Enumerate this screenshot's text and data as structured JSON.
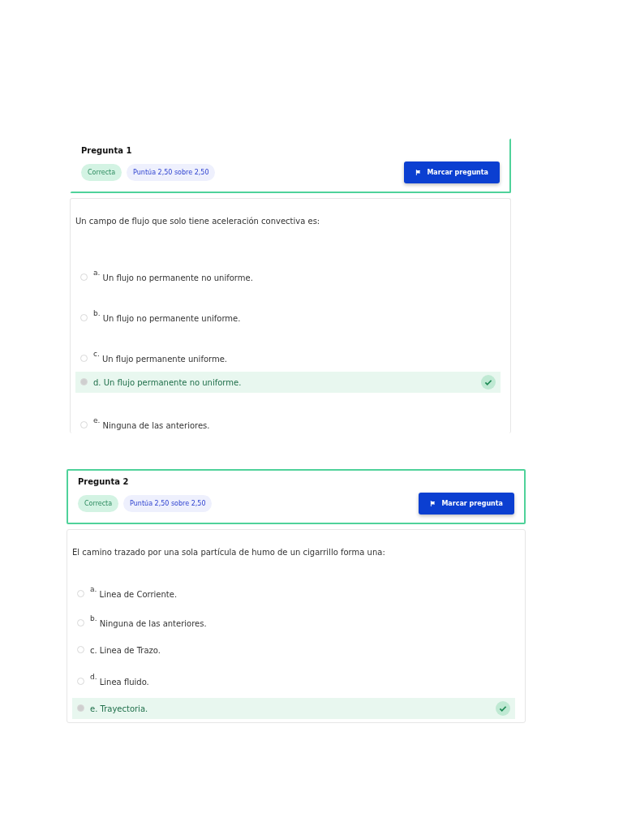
{
  "questions": [
    {
      "title": "Pregunta 1",
      "status": "Correcta",
      "score": "Puntúa 2,50 sobre 2,50",
      "flag_button": "Marcar pregunta",
      "prompt": "Un campo de flujo que solo tiene aceleración convectiva es:",
      "options": [
        {
          "letter": "a.",
          "text": "Un flujo no permanente no uniforme.",
          "raised": true,
          "selected": false
        },
        {
          "letter": "b.",
          "text": "Un flujo no permanente uniforme.",
          "raised": true,
          "selected": false
        },
        {
          "letter": "c.",
          "text": "Un flujo permanente uniforme.",
          "raised": true,
          "selected": false
        },
        {
          "letter": "d.",
          "text": "Un flujo permanente no uniforme.",
          "raised": false,
          "selected": true
        },
        {
          "letter": "e.",
          "text": "Ninguna de las anteriores.",
          "raised": true,
          "selected": false
        }
      ]
    },
    {
      "title": "Pregunta 2",
      "status": "Correcta",
      "score": "Puntúa 2,50 sobre 2,50",
      "flag_button": "Marcar pregunta",
      "prompt": "El camino trazado por una sola partícula de humo de un cigarrillo forma una:",
      "options": [
        {
          "letter": "a.",
          "text": "Linea de Corriente.",
          "raised": true,
          "selected": false
        },
        {
          "letter": "b.",
          "text": "Ninguna de las anteriores.",
          "raised": true,
          "selected": false
        },
        {
          "letter": "c.",
          "text": "Linea de Trazo.",
          "raised": false,
          "selected": false
        },
        {
          "letter": "d.",
          "text": "Linea fluido.",
          "raised": true,
          "selected": false
        },
        {
          "letter": "e.",
          "text": "Trayectoria.",
          "raised": false,
          "selected": true
        }
      ]
    }
  ]
}
